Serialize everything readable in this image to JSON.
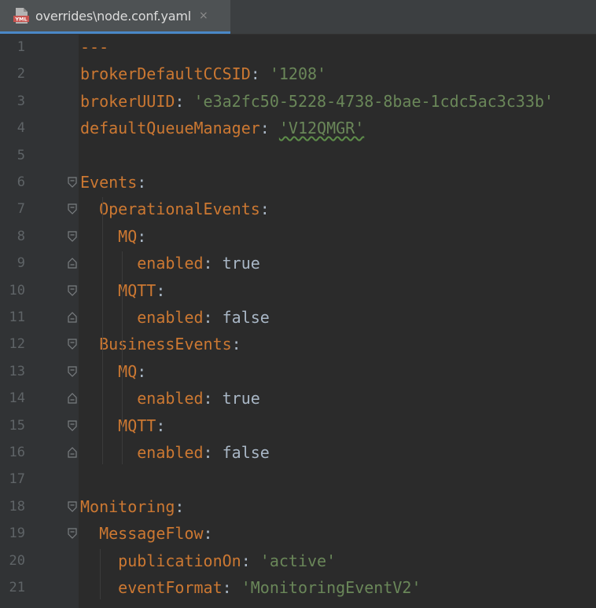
{
  "tab": {
    "filename": "overrides\\node.conf.yaml",
    "icon": "yaml-file-icon",
    "close": "×"
  },
  "lines": [
    {
      "n": "1",
      "tokens": [
        {
          "t": "---",
          "c": "key"
        }
      ]
    },
    {
      "n": "2",
      "tokens": [
        {
          "t": "brokerDefaultCCSID",
          "c": "key"
        },
        {
          "t": ": ",
          "c": "plain"
        },
        {
          "t": "'1208'",
          "c": "str"
        }
      ]
    },
    {
      "n": "3",
      "tokens": [
        {
          "t": "brokerUUID",
          "c": "key"
        },
        {
          "t": ": ",
          "c": "plain"
        },
        {
          "t": "'e3a2fc50-5228-4738-8bae-1cdc5ac3c33b'",
          "c": "str"
        }
      ]
    },
    {
      "n": "4",
      "tokens": [
        {
          "t": "defaultQueueManager",
          "c": "key"
        },
        {
          "t": ": ",
          "c": "plain"
        },
        {
          "t": "'V12QMGR'",
          "c": "str"
        }
      ]
    },
    {
      "n": "5",
      "tokens": []
    },
    {
      "n": "6",
      "tokens": [
        {
          "t": "Events",
          "c": "key"
        },
        {
          "t": ":",
          "c": "plain"
        }
      ],
      "fold": "open"
    },
    {
      "n": "7",
      "tokens": [
        {
          "t": "  OperationalEvents",
          "c": "key"
        },
        {
          "t": ":",
          "c": "plain"
        }
      ],
      "fold": "open"
    },
    {
      "n": "8",
      "tokens": [
        {
          "t": "    MQ",
          "c": "key"
        },
        {
          "t": ":",
          "c": "plain"
        }
      ],
      "fold": "open"
    },
    {
      "n": "9",
      "tokens": [
        {
          "t": "      enabled",
          "c": "key"
        },
        {
          "t": ": true",
          "c": "plain"
        }
      ],
      "fold": "close"
    },
    {
      "n": "10",
      "tokens": [
        {
          "t": "    MQTT",
          "c": "key"
        },
        {
          "t": ":",
          "c": "plain"
        }
      ],
      "fold": "open"
    },
    {
      "n": "11",
      "tokens": [
        {
          "t": "      enabled",
          "c": "key"
        },
        {
          "t": ": false",
          "c": "plain"
        }
      ],
      "fold": "close"
    },
    {
      "n": "12",
      "tokens": [
        {
          "t": "  BusinessEvents",
          "c": "key"
        },
        {
          "t": ":",
          "c": "plain"
        }
      ],
      "fold": "open"
    },
    {
      "n": "13",
      "tokens": [
        {
          "t": "    MQ",
          "c": "key"
        },
        {
          "t": ":",
          "c": "plain"
        }
      ],
      "fold": "open"
    },
    {
      "n": "14",
      "tokens": [
        {
          "t": "      enabled",
          "c": "key"
        },
        {
          "t": ": true",
          "c": "plain"
        }
      ],
      "fold": "close"
    },
    {
      "n": "15",
      "tokens": [
        {
          "t": "    MQTT",
          "c": "key"
        },
        {
          "t": ":",
          "c": "plain"
        }
      ],
      "fold": "open"
    },
    {
      "n": "16",
      "tokens": [
        {
          "t": "      enabled",
          "c": "key"
        },
        {
          "t": ": false",
          "c": "plain"
        }
      ],
      "fold": "close"
    },
    {
      "n": "17",
      "tokens": []
    },
    {
      "n": "18",
      "tokens": [
        {
          "t": "Monitoring",
          "c": "key"
        },
        {
          "t": ":",
          "c": "plain"
        }
      ],
      "fold": "open"
    },
    {
      "n": "19",
      "tokens": [
        {
          "t": "  MessageFlow",
          "c": "key"
        },
        {
          "t": ":",
          "c": "plain"
        }
      ],
      "fold": "open"
    },
    {
      "n": "20",
      "tokens": [
        {
          "t": "    publicationOn",
          "c": "key"
        },
        {
          "t": ": ",
          "c": "plain"
        },
        {
          "t": "'active'",
          "c": "str"
        }
      ]
    },
    {
      "n": "21",
      "tokens": [
        {
          "t": "    eventFormat",
          "c": "key"
        },
        {
          "t": ": ",
          "c": "plain"
        },
        {
          "t": "'MonitoringEventV2'",
          "c": "str"
        }
      ]
    }
  ],
  "colors": {
    "key": "#cc7832",
    "string": "#6a8759",
    "plain": "#a9b7c6",
    "background": "#2b2b2b",
    "tab_underline": "#4a88c7"
  }
}
